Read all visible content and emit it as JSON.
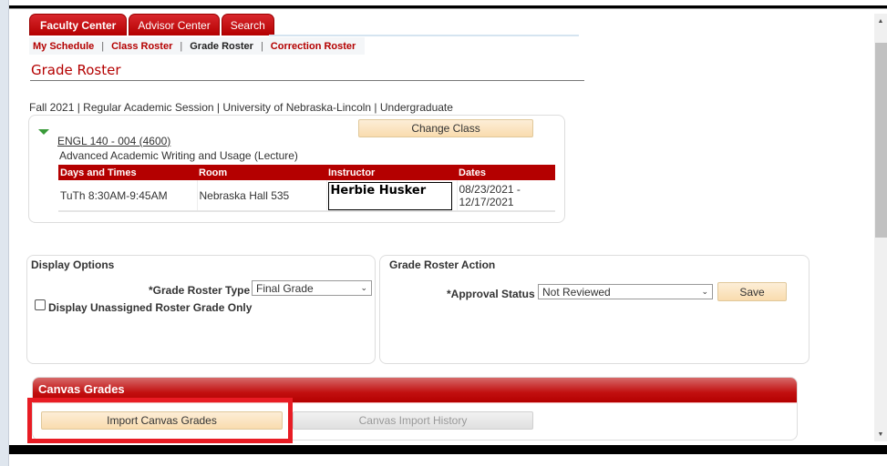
{
  "tabs": [
    {
      "label": "Faculty Center",
      "active": true
    },
    {
      "label": "Advisor Center",
      "active": false
    },
    {
      "label": "Search",
      "active": false
    }
  ],
  "subnav": {
    "items": [
      "My Schedule",
      "Class Roster",
      "Grade Roster",
      "Correction Roster"
    ],
    "current": "Grade Roster",
    "separator": "|"
  },
  "page_title": "Grade Roster",
  "term_line": "Fall 2021 | Regular Academic Session | University of Nebraska-Lincoln | Undergraduate",
  "class_info": {
    "change_class_label": "Change Class",
    "course_link": "ENGL 140 - 004 (4600)",
    "course_desc": "Advanced Academic Writing and Usage (Lecture)",
    "columns": [
      "Days and Times",
      "Room",
      "Instructor",
      "Dates"
    ],
    "rows": [
      {
        "days_times": "TuTh 8:30AM-9:45AM",
        "room": "Nebraska Hall 535",
        "instructor": "Herbie Husker",
        "dates": "08/23/2021 - 12/17/2021"
      }
    ]
  },
  "display_options": {
    "title": "Display Options",
    "roster_type_label": "*Grade Roster Type",
    "roster_type_value": "Final Grade",
    "unassigned_label": "Display Unassigned Roster Grade Only",
    "unassigned_checked": false
  },
  "grade_roster_action": {
    "title": "Grade Roster Action",
    "approval_label": "*Approval Status",
    "approval_value": "Not Reviewed",
    "save_label": "Save"
  },
  "canvas_grades": {
    "title": "Canvas Grades",
    "import_label": "Import Canvas Grades",
    "history_label": "Canvas Import History"
  },
  "icons": {
    "collapse": "triangle-down",
    "select_chevron": "⌄",
    "scroll_up": "▲",
    "scroll_down": "▼"
  },
  "colors": {
    "brand_red": "#b40000",
    "highlight_red": "#e81c24",
    "button_tan": "#f9dcae"
  }
}
